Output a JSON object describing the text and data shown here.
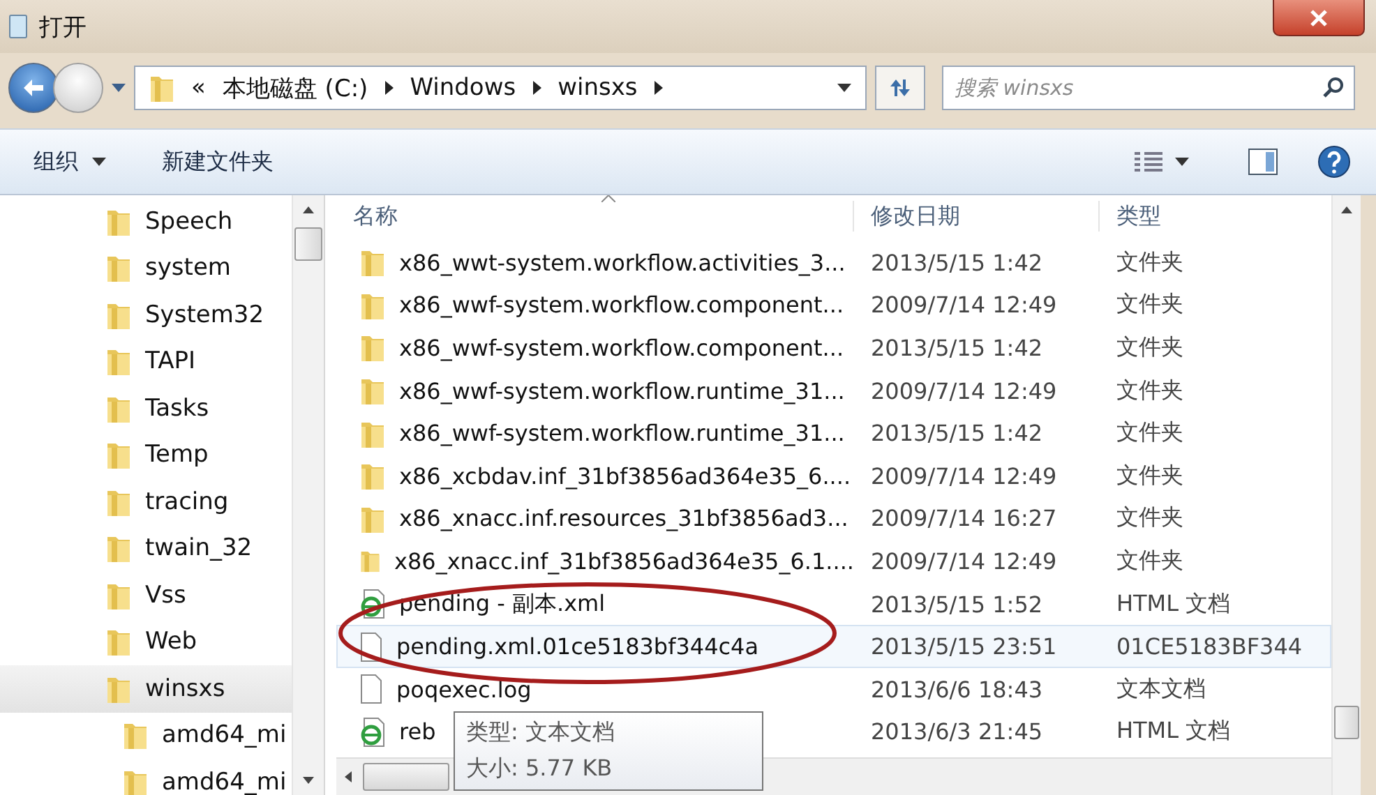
{
  "window": {
    "title": "打开"
  },
  "address_bar": {
    "overflow": "«",
    "breadcrumbs": [
      "本地磁盘 (C:)",
      "Windows",
      "winsxs"
    ],
    "back_enabled": true,
    "forward_enabled": false
  },
  "search": {
    "placeholder": "搜索 winsxs"
  },
  "toolbar": {
    "organize": "组织",
    "new_folder": "新建文件夹"
  },
  "nav_tree": [
    {
      "label": "Speech",
      "selected": false
    },
    {
      "label": "system",
      "selected": false
    },
    {
      "label": "System32",
      "selected": false
    },
    {
      "label": "TAPI",
      "selected": false
    },
    {
      "label": "Tasks",
      "selected": false
    },
    {
      "label": "Temp",
      "selected": false
    },
    {
      "label": "tracing",
      "selected": false
    },
    {
      "label": "twain_32",
      "selected": false
    },
    {
      "label": "Vss",
      "selected": false
    },
    {
      "label": "Web",
      "selected": false
    },
    {
      "label": "winsxs",
      "selected": true,
      "children": [
        {
          "label": "amd64_mi",
          "selected": false
        },
        {
          "label": "amd64_mi",
          "selected": false
        }
      ]
    }
  ],
  "table": {
    "columns": [
      "名称",
      "修改日期",
      "类型"
    ],
    "rows": [
      {
        "kind": "folder",
        "name": "x86_wwt-system.workflow.activities_3...",
        "date": "2013/5/15 1:42",
        "type": "文件夹",
        "selected": false
      },
      {
        "kind": "folder",
        "name": "x86_wwf-system.workflow.component...",
        "date": "2009/7/14 12:49",
        "type": "文件夹",
        "selected": false
      },
      {
        "kind": "folder",
        "name": "x86_wwf-system.workflow.component...",
        "date": "2013/5/15 1:42",
        "type": "文件夹",
        "selected": false
      },
      {
        "kind": "folder",
        "name": "x86_wwf-system.workflow.runtime_31...",
        "date": "2009/7/14 12:49",
        "type": "文件夹",
        "selected": false
      },
      {
        "kind": "folder",
        "name": "x86_wwf-system.workflow.runtime_31...",
        "date": "2013/5/15 1:42",
        "type": "文件夹",
        "selected": false
      },
      {
        "kind": "folder",
        "name": "x86_xcbdav.inf_31bf3856ad364e35_6....",
        "date": "2009/7/14 12:49",
        "type": "文件夹",
        "selected": false
      },
      {
        "kind": "folder",
        "name": "x86_xnacc.inf.resources_31bf3856ad3...",
        "date": "2009/7/14 16:27",
        "type": "文件夹",
        "selected": false
      },
      {
        "kind": "folder",
        "name": "x86_xnacc.inf_31bf3856ad364e35_6.1....",
        "date": "2009/7/14 12:49",
        "type": "文件夹",
        "selected": false
      },
      {
        "kind": "html",
        "name": "pending - 副本.xml",
        "date": "2013/5/15 1:52",
        "type": "HTML 文档",
        "selected": false
      },
      {
        "kind": "file",
        "name": "pending.xml.01ce5183bf344c4a",
        "date": "2013/5/15 23:51",
        "type": "01CE5183BF344",
        "selected": true
      },
      {
        "kind": "file",
        "name": "poqexec.log",
        "date": "2013/6/6 18:43",
        "type": "文本文档",
        "selected": false
      },
      {
        "kind": "html",
        "name": "reb",
        "date": "2013/6/3 21:45",
        "type": "HTML 文档",
        "selected": false
      }
    ]
  },
  "tooltip": {
    "lines": [
      "类型: 文本文档",
      "大小: 5.77 KB"
    ]
  }
}
